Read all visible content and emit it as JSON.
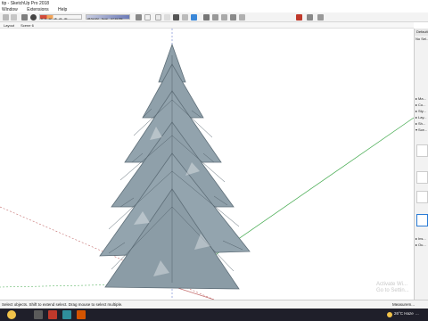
{
  "window": {
    "title": "tip - SketchUp Pro 2018"
  },
  "menu": [
    "Window",
    "Extensions",
    "Help"
  ],
  "toolbar": {
    "scale_labels": [
      "0",
      "6",
      "12",
      "18",
      "24",
      "30"
    ],
    "time_labels": [
      "05:52 AM",
      "Noon",
      "07:19 PM"
    ],
    "layer_value": "Layer0"
  },
  "scene_tabs": [
    "Layout",
    "Scene 6"
  ],
  "tray": {
    "header": "Default T...",
    "sub": "No Sel...",
    "items": [
      "Ma...",
      "Co...",
      "Sty...",
      "Lay...",
      "Sh...",
      "Sce..."
    ],
    "lower_items": [
      "Ins...",
      "Ou..."
    ]
  },
  "status": {
    "hint": "Select objects. Shift to extend select. Drag mouse to select multiple.",
    "measure_label": "Measurem..."
  },
  "watermark": [
    "Activate Wi...",
    "Go to Settin..."
  ],
  "taskbar": {
    "weather": "26°C Haze",
    "time": "..."
  },
  "colors": {
    "tree_fill": "#8fa0aa",
    "tree_dark": "#5e6e78",
    "axis_green": "#3fa84a",
    "axis_red": "#c46d6d",
    "axis_blue": "#6a7fd0",
    "taskbar": "#1f1f2a",
    "select_blue": "#2a7bd6"
  }
}
